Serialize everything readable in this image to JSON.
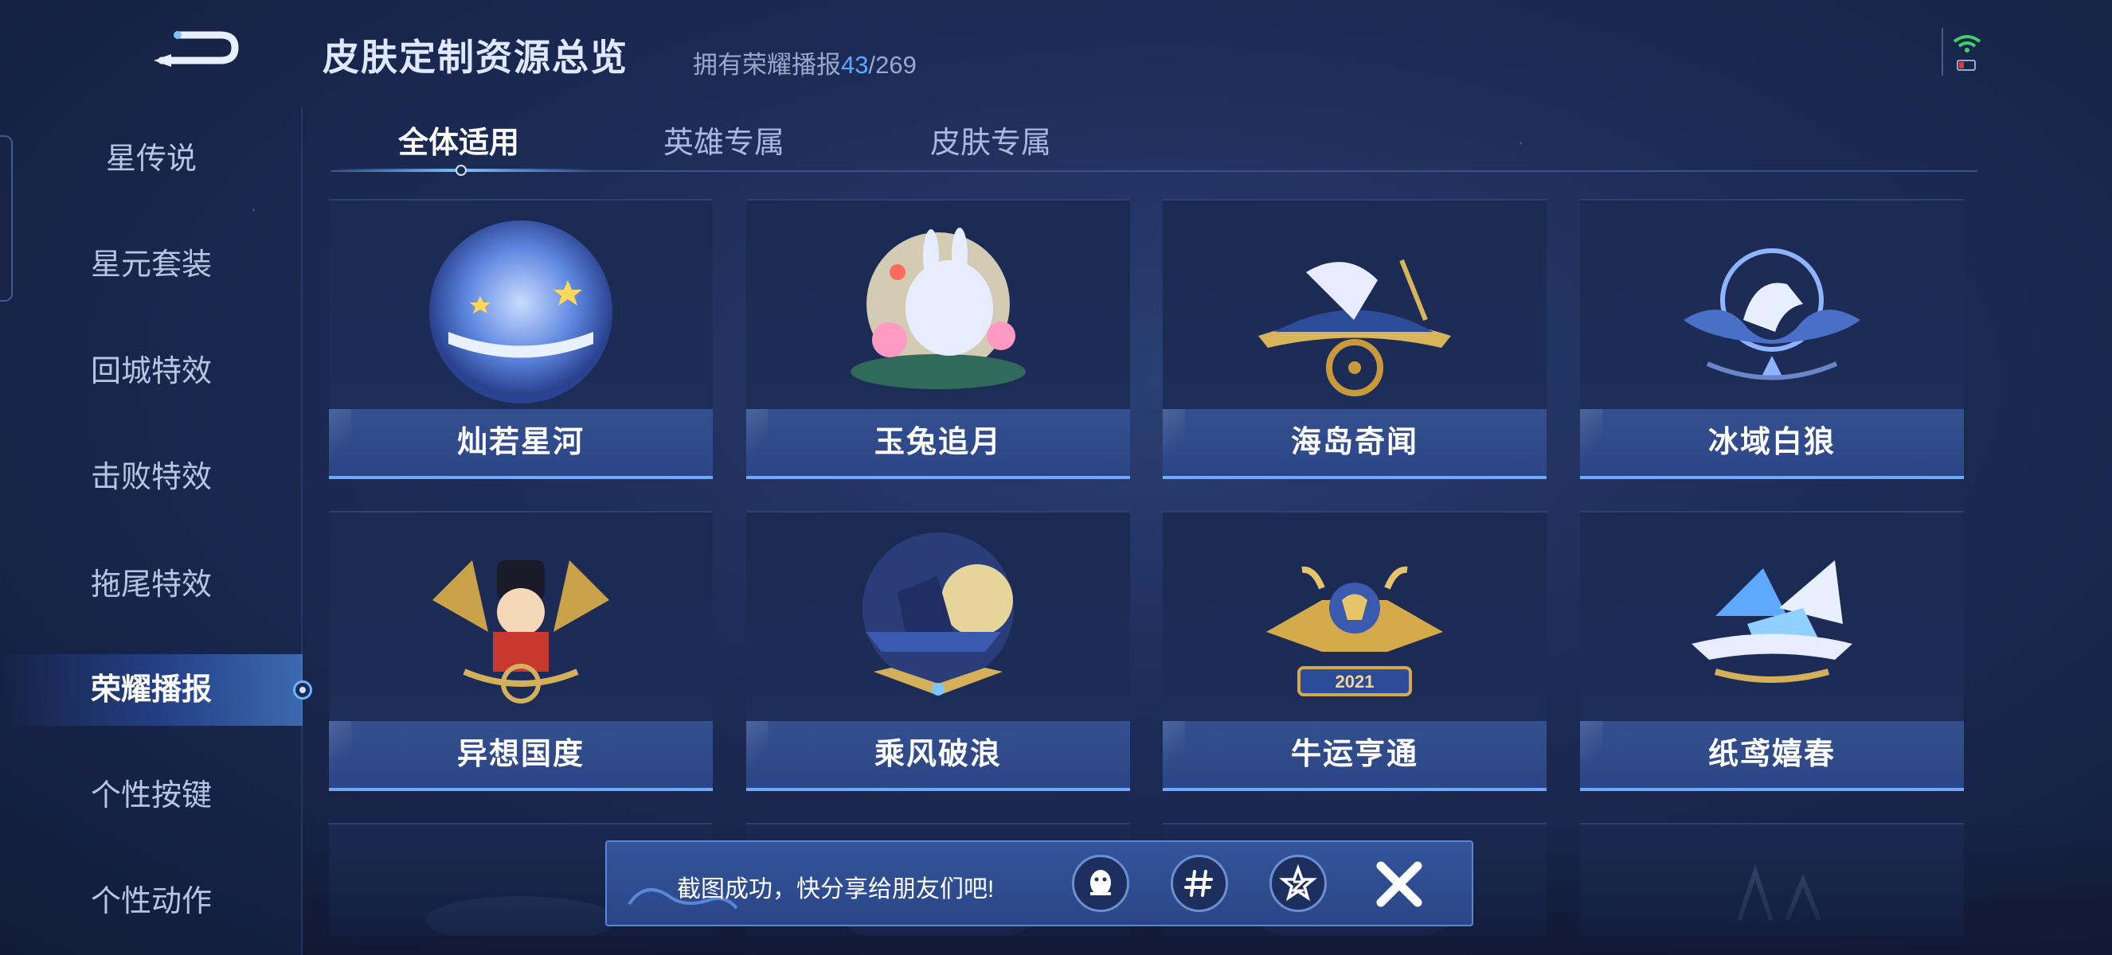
{
  "header": {
    "title": "皮肤定制资源总览",
    "owned_prefix": "拥有荣耀播报",
    "owned_count": "43",
    "owned_total": "/269"
  },
  "sidebar": {
    "items": [
      {
        "label": "星传说"
      },
      {
        "label": "星元套装"
      },
      {
        "label": "回城特效"
      },
      {
        "label": "击败特效"
      },
      {
        "label": "拖尾特效"
      },
      {
        "label": "荣耀播报",
        "active": true
      },
      {
        "label": "个性按键"
      },
      {
        "label": "个性动作"
      }
    ]
  },
  "tabs": [
    {
      "label": "全体适用",
      "active": true
    },
    {
      "label": "英雄专属"
    },
    {
      "label": "皮肤专属"
    }
  ],
  "cards": [
    {
      "name": "灿若星河",
      "icon": "moon-star-emblem-icon"
    },
    {
      "name": "玉兔追月",
      "icon": "jade-rabbit-emblem-icon"
    },
    {
      "name": "海岛奇闻",
      "icon": "island-ship-emblem-icon"
    },
    {
      "name": "冰域白狼",
      "icon": "ice-wolf-emblem-icon"
    },
    {
      "name": "异想国度",
      "icon": "toy-soldier-emblem-icon"
    },
    {
      "name": "乘风破浪",
      "icon": "sailing-ship-emblem-icon"
    },
    {
      "name": "牛运亨通",
      "icon": "golden-ox-emblem-icon",
      "badge_text": "2021"
    },
    {
      "name": "纸鸢嬉春",
      "icon": "paper-kite-emblem-icon"
    }
  ],
  "toast": {
    "message": "截图成功，快分享给朋友们吧!",
    "share_targets": [
      {
        "icon": "qq-penguin-icon"
      },
      {
        "icon": "wechat-moments-icon"
      },
      {
        "icon": "qzone-star-icon"
      }
    ],
    "close_icon": "close-icon"
  },
  "colors": {
    "accent": "#6fa8ff",
    "count_highlight": "#5aa8ff",
    "card_label_bg": "#2c4586",
    "background": "#1c2b55"
  }
}
